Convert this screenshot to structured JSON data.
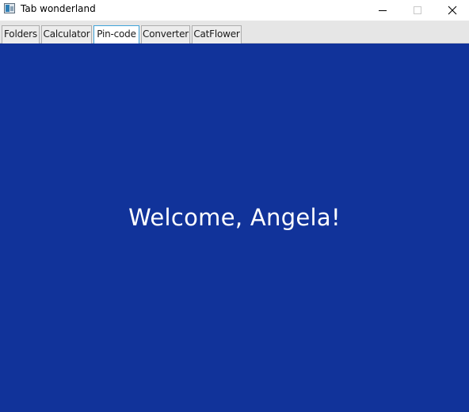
{
  "window": {
    "title": "Tab wonderland",
    "icon": "app-window-icon",
    "controls": [
      "minimize-icon",
      "maximize-icon",
      "close-icon"
    ]
  },
  "tabs": [
    {
      "label": "Folders",
      "active": false
    },
    {
      "label": "Calculator",
      "active": false
    },
    {
      "label": "Pin-code",
      "active": true
    },
    {
      "label": "Converter",
      "active": false
    },
    {
      "label": "CatFlower",
      "active": false
    }
  ],
  "content": {
    "message": "Welcome, Angela!",
    "background_color": "#11339a",
    "text_color": "#ffffff"
  },
  "colors": {
    "active_tab_border": "#3fa3d9",
    "tabbar_bg": "#e6e6e6"
  }
}
